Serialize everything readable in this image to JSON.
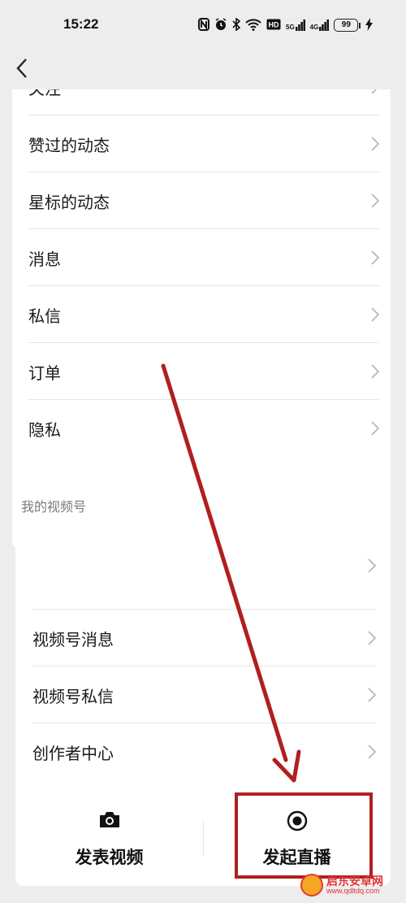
{
  "status_bar": {
    "time": "15:22",
    "network": "5G",
    "network2": "4G",
    "battery": "99"
  },
  "menu": {
    "items": [
      {
        "label": "关注"
      },
      {
        "label": "赞过的动态"
      },
      {
        "label": "星标的动态"
      },
      {
        "label": "消息"
      },
      {
        "label": "私信"
      },
      {
        "label": "订单"
      },
      {
        "label": "隐私"
      }
    ]
  },
  "channels": {
    "section_title": "我的视频号",
    "items": [
      {
        "label": ""
      },
      {
        "label": "视频号消息"
      },
      {
        "label": "视频号私信"
      },
      {
        "label": "创作者中心"
      }
    ],
    "actions": {
      "post_video": "发表视频",
      "start_live": "发起直播"
    }
  },
  "annotation": {
    "color": "#b01f1f"
  },
  "watermark": {
    "title": "启东安卓网",
    "url": "www.qdltdq.com"
  }
}
